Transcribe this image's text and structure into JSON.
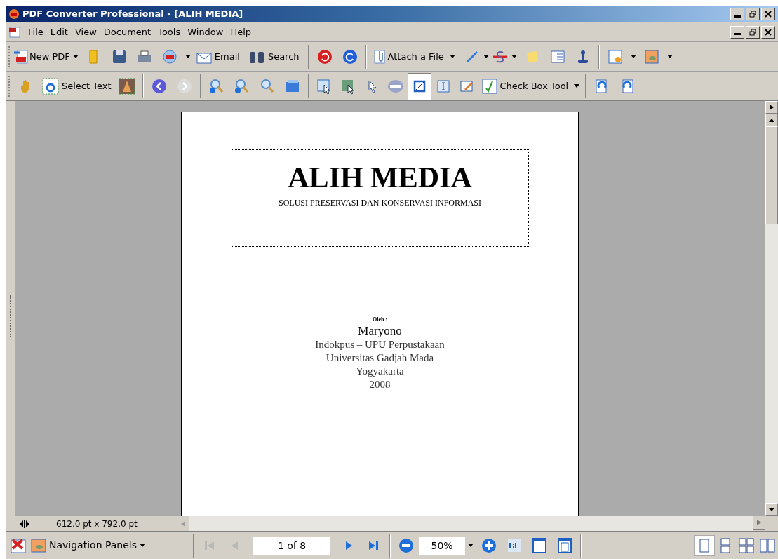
{
  "window": {
    "title": "PDF Converter Professional - [ALIH MEDIA]"
  },
  "menu": [
    "File",
    "Edit",
    "View",
    "Document",
    "Tools",
    "Window",
    "Help"
  ],
  "toolbar_1": {
    "new_pdf": "New PDF",
    "email": "Email",
    "search": "Search",
    "attach": "Attach a File"
  },
  "toolbar_2": {
    "select_text": "Select Text",
    "tools": [
      {
        "selected": false
      },
      {
        "selected": false
      },
      {
        "selected": false
      },
      {
        "selected": false
      },
      {
        "selected": true
      },
      {
        "selected": false
      },
      {
        "selected": false
      }
    ],
    "check_box": "Check Box Tool"
  },
  "document": {
    "title": "ALIH MEDIA",
    "subtitle": "SOLUSI PRESERVASI DAN KONSERVASI INFORMASI",
    "by_label": "Oleh :",
    "lines": [
      "Maryono",
      "Indokpus – UPU Perpustakaan",
      "Universitas Gadjah Mada",
      "Yogyakarta",
      "2008"
    ]
  },
  "page_size": "612.0 pt x 792.0 pt",
  "status_bar": {
    "navigation": "Navigation Panels",
    "first_disabled": true,
    "prev_disabled": true,
    "next_disabled": false,
    "last_disabled": false,
    "page": "1 of 8",
    "zoom": "50%",
    "views": [
      {
        "selected": true
      },
      {
        "selected": false
      },
      {
        "selected": false
      },
      {
        "selected": false
      }
    ]
  }
}
